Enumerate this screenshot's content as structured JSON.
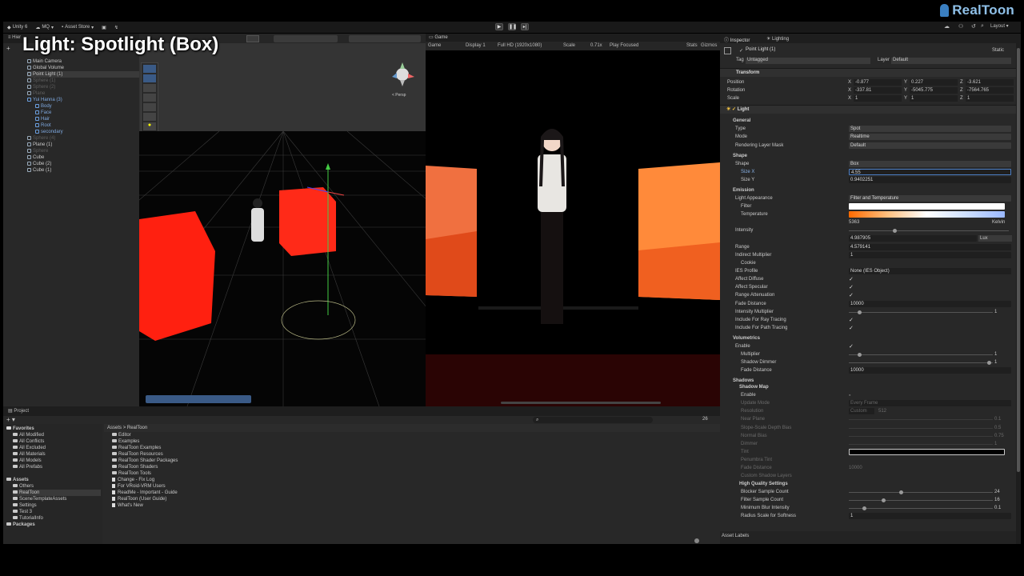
{
  "brand": {
    "name": "RealToon"
  },
  "overlay_title": "Light: Spotlight (Box)",
  "toolbar": {
    "unity": "Unity 6",
    "account": "MQ",
    "asset_store": "Asset Store",
    "layout": "Layout"
  },
  "hierarchy": {
    "tab": "Hier",
    "items": [
      {
        "label": "Main Camera",
        "indent": 1,
        "dim": false
      },
      {
        "label": "Global Volume",
        "indent": 1,
        "dim": false
      },
      {
        "label": "Point Light (1)",
        "indent": 1,
        "dim": false,
        "selected": true
      },
      {
        "label": "Sphere (1)",
        "indent": 1,
        "dim": true
      },
      {
        "label": "Sphere (2)",
        "indent": 1,
        "dim": true
      },
      {
        "label": "Plane",
        "indent": 1,
        "dim": true
      },
      {
        "label": "Yui Hanna (3)",
        "indent": 1,
        "dim": false,
        "accent": true
      },
      {
        "label": "Body",
        "indent": 2,
        "dim": false,
        "accent": true
      },
      {
        "label": "Face",
        "indent": 2,
        "dim": false,
        "accent": true
      },
      {
        "label": "Hair",
        "indent": 2,
        "dim": false,
        "accent": true
      },
      {
        "label": "Root",
        "indent": 2,
        "dim": false,
        "accent": true
      },
      {
        "label": "secondary",
        "indent": 2,
        "dim": false,
        "accent": true
      },
      {
        "label": "Sphere (4)",
        "indent": 1,
        "dim": true
      },
      {
        "label": "Plane (1)",
        "indent": 1,
        "dim": false
      },
      {
        "label": "Sphere",
        "indent": 1,
        "dim": true
      },
      {
        "label": "Cube",
        "indent": 1,
        "dim": false
      },
      {
        "label": "Cube (2)",
        "indent": 1,
        "dim": false
      },
      {
        "label": "Cube (1)",
        "indent": 1,
        "dim": false
      }
    ]
  },
  "scene": {
    "gizmo_label": "< Persp"
  },
  "game": {
    "tab": "Game",
    "view": "Game",
    "display": "Display 1",
    "resolution": "Full HD (1920x1080)",
    "scale_label": "Scale",
    "scale_value": "0.71x",
    "play_mode": "Play Focused",
    "stats": "Stats",
    "gizmos": "Gizmos"
  },
  "inspector": {
    "tab_inspector": "Inspector",
    "tab_lighting": "Lighting",
    "object_name": "Point Light (1)",
    "static_label": "Static",
    "tag_label": "Tag",
    "tag_value": "Untagged",
    "layer_label": "Layer",
    "layer_value": "Default",
    "transform": {
      "title": "Transform",
      "rows": [
        {
          "label": "Position",
          "x": "-0.877",
          "y": "0.227",
          "z": "-3.621"
        },
        {
          "label": "Rotation",
          "x": "-337.81",
          "y": "-5045.775",
          "z": "-7564.765"
        },
        {
          "label": "Scale",
          "x": "1",
          "y": "1",
          "z": "1"
        }
      ]
    },
    "light": {
      "title": "Light",
      "general": "General",
      "type_label": "Type",
      "type_value": "Spot",
      "mode_label": "Mode",
      "mode_value": "Realtime",
      "rlm_label": "Rendering Layer Mask",
      "rlm_value": "Default",
      "shape": "Shape",
      "shape_label": "Shape",
      "shape_value": "Box",
      "sizex_label": "Size X",
      "sizex_value": "4.55",
      "sizey_label": "Size Y",
      "sizey_value": "0.9402251",
      "emission": "Emission",
      "appearance_label": "Light Appearance",
      "appearance_value": "Filter and Temperature",
      "filter_label": "Filter",
      "temperature_label": "Temperature",
      "temperature_value": "5363",
      "temperature_unit": "Kelvin",
      "intensity_label": "Intensity",
      "intensity_value": "4.987905",
      "intensity_unit": "Lux",
      "range_label": "Range",
      "range_value": "4.579141",
      "indirect_label": "Indirect Multiplier",
      "indirect_value": "1",
      "cookie_label": "Cookie",
      "ies_label": "IES Profile",
      "ies_value": "None (IES Object)",
      "affect_diffuse": "Affect Diffuse",
      "affect_specular": "Affect Specular",
      "range_atten": "Range Attenuation",
      "fade_label": "Fade Distance",
      "fade_value": "10000",
      "intensity_mult_label": "Intensity Multiplier",
      "intensity_mult_value": "1",
      "include_ray": "Include For Ray Tracing",
      "include_path": "Include For Path Tracing",
      "volumetrics": "Volumetrics",
      "enable_label": "Enable",
      "multiplier_label": "Multiplier",
      "multiplier_value": "1",
      "shadow_dimmer_label": "Shadow Dimmer",
      "shadow_dimmer_value": "1",
      "vol_fade_label": "Fade Distance",
      "vol_fade_value": "10000",
      "shadows": "Shadows",
      "shadow_map": "Shadow Map",
      "sm_enable": "Enable",
      "update_mode_label": "Update Mode",
      "update_mode_value": "Every Frame",
      "resolution_label": "Resolution",
      "resolution_value": "Custom",
      "resolution_num": "512",
      "near_plane_label": "Near Plane",
      "near_plane_value": "0.1",
      "slope_label": "Slope-Scale Depth Bias",
      "slope_value": "0.5",
      "normal_bias_label": "Normal Bias",
      "normal_bias_value": "0.75",
      "dimmer_label": "Dimmer",
      "dimmer_value": "1",
      "tint_label": "Tint",
      "penumbra_label": "Penumbra Tint",
      "sfade_label": "Fade Distance",
      "sfade_value": "10000",
      "custom_layers_label": "Custom Shadow Layers",
      "hq": "High Quality Settings",
      "blocker_label": "Blocker Sample Count",
      "blocker_value": "24",
      "filter_count_label": "Filter Sample Count",
      "filter_count_value": "16",
      "min_blur_label": "Minimum Blur Intensity",
      "min_blur_value": "0.1",
      "radius_label": "Radius Scale for Softness",
      "radius_value": "1"
    },
    "asset_labels": "Asset Labels"
  },
  "project": {
    "tab": "Project",
    "breadcrumb_root": "Assets",
    "breadcrumb_sep": ">",
    "breadcrumb_current": "RealToon",
    "count": "26",
    "favorites_title": "Favorites",
    "favorites": [
      "All Modified",
      "All Conflicts",
      "All Excluded",
      "All Materials",
      "All Models",
      "All Prefabs"
    ],
    "assets_title": "Assets",
    "assets": [
      "Others",
      "RealToon",
      "SceneTemplateAssets",
      "Settings",
      "Test 3",
      "TutorialInfo"
    ],
    "packages_title": "Packages",
    "files": [
      {
        "name": "Editor",
        "kind": "folder"
      },
      {
        "name": "Examples",
        "kind": "folder"
      },
      {
        "name": "RealToon Examples",
        "kind": "folder"
      },
      {
        "name": "RealToon Resources",
        "kind": "folder"
      },
      {
        "name": "RealToon Shader Packages",
        "kind": "folder"
      },
      {
        "name": "RealToon Shaders",
        "kind": "folder"
      },
      {
        "name": "RealToon Tools",
        "kind": "folder"
      },
      {
        "name": "Change - Fix Log",
        "kind": "doc"
      },
      {
        "name": "For VRoid-VRM Users",
        "kind": "doc"
      },
      {
        "name": "ReadMe - Important - Guide",
        "kind": "doc"
      },
      {
        "name": "RealToon (User Guide)",
        "kind": "doc"
      },
      {
        "name": "What's New",
        "kind": "doc"
      }
    ]
  },
  "colors": {
    "accent_blue": "#4c7fc6",
    "brand": "#8fc0e8",
    "panel": "#282828",
    "red_cube": "#ff2a1a",
    "orange_light": "#ff7a3a"
  }
}
